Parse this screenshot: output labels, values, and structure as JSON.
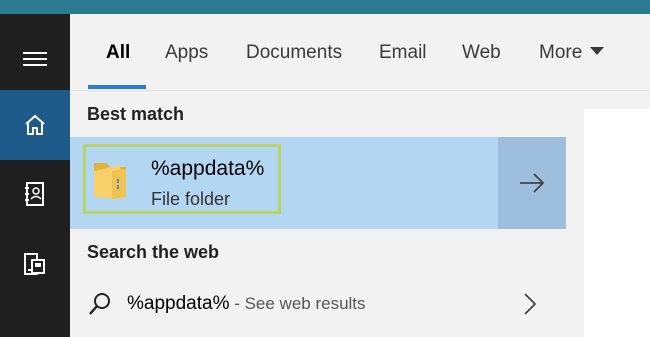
{
  "tabs": [
    {
      "label": "All",
      "active": true
    },
    {
      "label": "Apps"
    },
    {
      "label": "Documents"
    },
    {
      "label": "Email"
    },
    {
      "label": "Web"
    },
    {
      "label": "More"
    }
  ],
  "sidebar": {
    "items": [
      {
        "icon": "hamburger-menu-icon"
      },
      {
        "icon": "home-icon",
        "active": true
      },
      {
        "icon": "notebook-icon"
      },
      {
        "icon": "devices-icon"
      }
    ]
  },
  "best_match": {
    "header": "Best match",
    "title": "%appdata%",
    "subtitle": "File folder",
    "icon": "folder-icon"
  },
  "web": {
    "header": "Search the web",
    "query": "%appdata%",
    "suffix": " - See web results"
  },
  "colors": {
    "accent": "#2c7bd6",
    "rail_bg": "#1f1f1f",
    "rail_active": "#1e5a8a",
    "selected_row": "#b3d7f2",
    "arrow_button": "#9dbedc",
    "highlight_border": "#b9d56a"
  }
}
